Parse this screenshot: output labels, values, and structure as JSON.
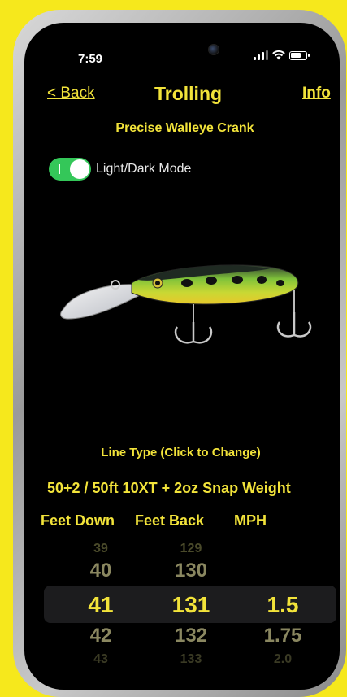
{
  "status_bar": {
    "time": "7:59"
  },
  "nav": {
    "back": "< Back",
    "title": "Trolling",
    "info": "Info"
  },
  "subtitle": "Precise Walleye Crank",
  "mode_toggle": {
    "label": "Light/Dark Mode",
    "state": "on"
  },
  "line_type": {
    "label": "Line Type (Click to Change)",
    "value": "50+2 / 50ft 10XT + 2oz Snap Weight"
  },
  "columns": [
    "Feet Down",
    "Feet Back",
    "MPH"
  ],
  "picker": {
    "feet_down": [
      "39",
      "40",
      "41",
      "42",
      "43"
    ],
    "feet_back": [
      "129",
      "130",
      "131",
      "132",
      "133"
    ],
    "mph": [
      "",
      "",
      "1.5",
      "1.75",
      "2.0"
    ]
  },
  "colors": {
    "accent": "#f2e33a",
    "toggle_on": "#34c759",
    "background": "#000000",
    "frame_bg": "#f6e81c"
  }
}
